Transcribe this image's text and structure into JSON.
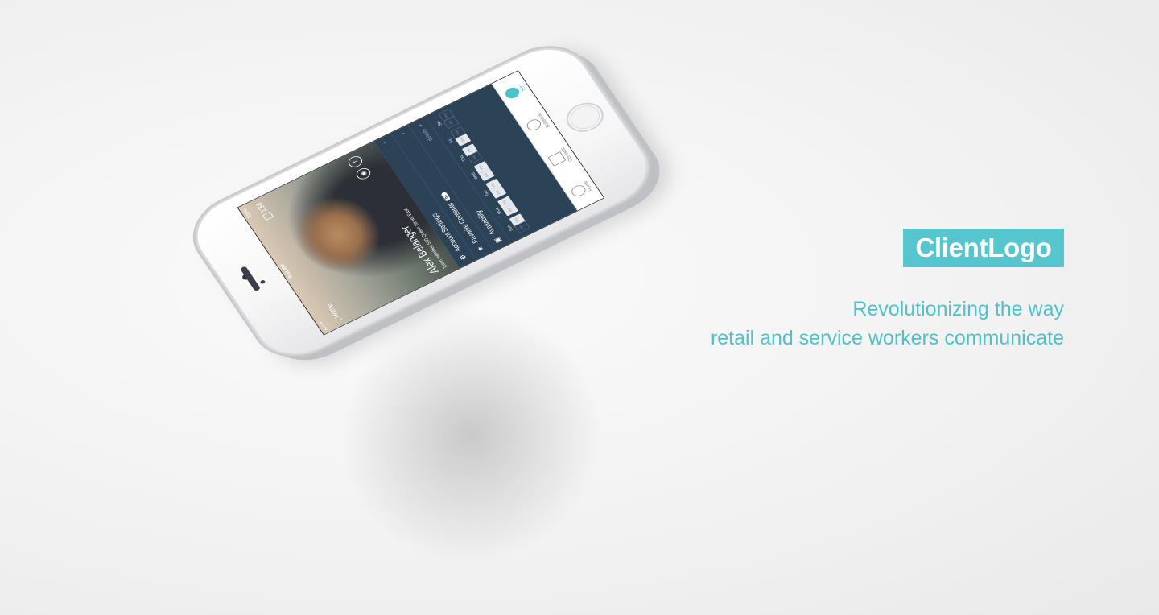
{
  "brand": {
    "logo_text": "ClientLogo",
    "color": "#56c5cc"
  },
  "tagline": {
    "line1": "Revolutionizing the way",
    "line2": "retail and service workers communicate",
    "color": "#4fc1c9"
  },
  "phone": {
    "status": {
      "signal": "•••••",
      "time": "9:41 AM",
      "battery": "100%"
    },
    "nav": {
      "back_label": "Home"
    },
    "message_count": "134",
    "profile": {
      "name": "Alex Belanger",
      "role": "Team member, 550 Queen Street East"
    },
    "menu": {
      "account_settings": "Account Settings",
      "favorite_contents": "Favorite Contents",
      "favorite_count": "57",
      "availability": "Availability",
      "details": "details"
    },
    "availability": {
      "am_label": "AM",
      "pm_label": "PM",
      "days": [
        {
          "name": "Sun",
          "am": false,
          "pm": true
        },
        {
          "name": "Mon",
          "am": true,
          "pm": true
        },
        {
          "name": "Tue",
          "am": true,
          "pm": true
        },
        {
          "name": "Wed",
          "am": true,
          "pm": true
        },
        {
          "name": "Thu",
          "am": false,
          "pm": true
        },
        {
          "name": "Fri",
          "am": true,
          "pm": false
        },
        {
          "name": "Sat",
          "am": false,
          "pm": false
        }
      ]
    },
    "tabs": [
      {
        "label": "Home",
        "icon": "chat-bubble-icon",
        "active": false
      },
      {
        "label": "Contacts",
        "icon": "contacts-list-icon",
        "active": false
      },
      {
        "label": "Schedule",
        "icon": "clock-icon",
        "active": false
      },
      {
        "label": "Me",
        "icon": "person-icon",
        "active": true
      }
    ],
    "accent_color": "#4fc1c9",
    "panel_color": "#2c4257"
  }
}
